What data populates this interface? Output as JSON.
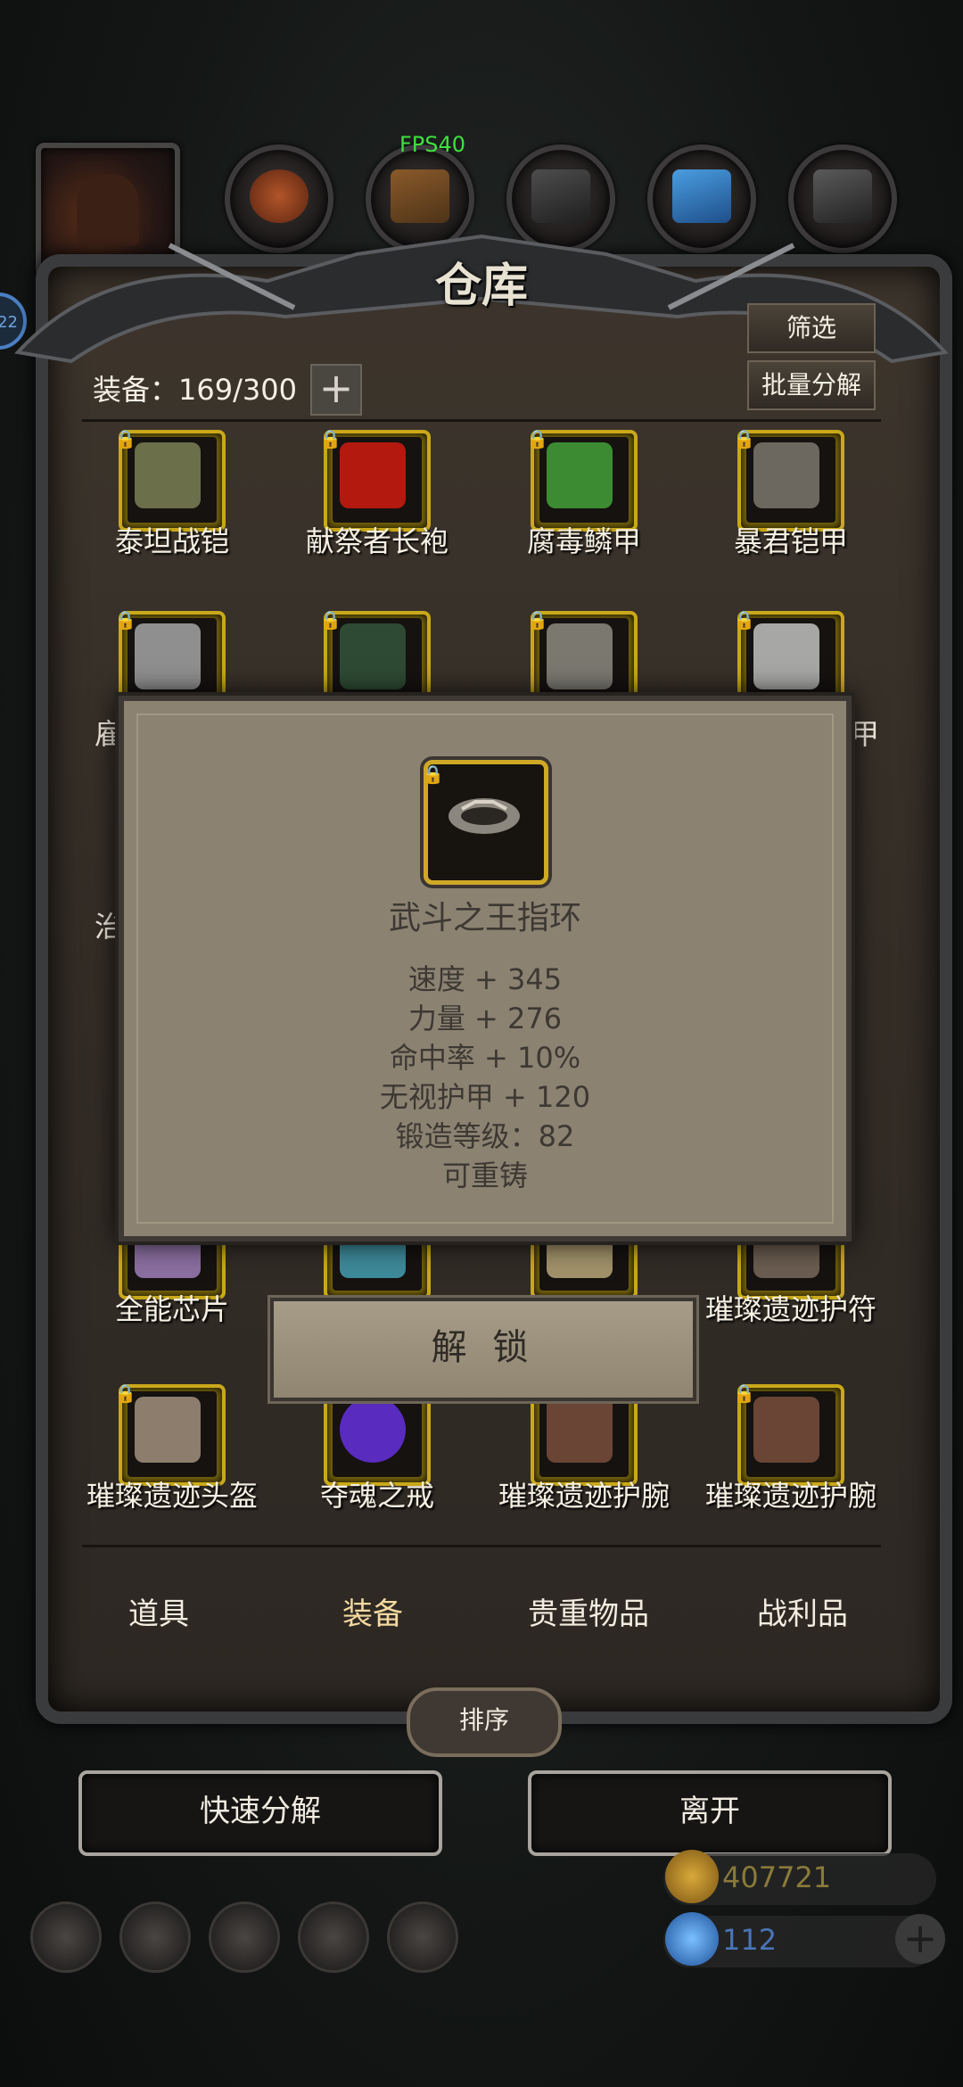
{
  "hud": {
    "fps": "FPS40"
  },
  "panel": {
    "title": "仓库",
    "filter_label": "筛选",
    "batch_label": "批量分解",
    "capacity_label": "装备：169/300",
    "plus_label": "+"
  },
  "items_row1": [
    {
      "name": "泰坦战铠",
      "color": "#6b6f4a"
    },
    {
      "name": "献祭者长袍",
      "color": "#b3190f"
    },
    {
      "name": "腐毒鳞甲",
      "color": "#3c8b32"
    },
    {
      "name": "暴君铠甲",
      "color": "#6c6860"
    }
  ],
  "items_row2_partial": [
    {
      "name": "",
      "color": "#8f8f8f"
    },
    {
      "name": "",
      "color": "#2e4a34"
    },
    {
      "name": "",
      "color": "#7b7870"
    },
    {
      "name": "",
      "color": "#a7a7a5"
    }
  ],
  "items_row4_partial": [
    {
      "name": "全能芯片",
      "color": "#8a6fa0"
    },
    {
      "name": "",
      "color": "#3d8a9a"
    },
    {
      "name": "",
      "color": "#a0916a"
    },
    {
      "name": "璀璨遗迹护符",
      "color": "#6a5c50"
    }
  ],
  "items_row5": [
    {
      "name": "璀璨遗迹头盔",
      "color": "#8d7d6c"
    },
    {
      "name": "夺魂之戒",
      "color": "#5a2bbf"
    },
    {
      "name": "璀璨遗迹护腕",
      "color": "#6a4535"
    },
    {
      "name": "璀璨遗迹护腕",
      "color": "#6a4535"
    }
  ],
  "partial_labels": {
    "left_r2": "雇",
    "right_r2": "甲",
    "left_r3": "治"
  },
  "popup": {
    "item_name": "武斗之王指环",
    "stats": [
      "速度 + 345",
      "力量 + 276",
      "命中率 + 10%",
      "无视护甲 + 120",
      "锻造等级：82",
      "可重铸"
    ]
  },
  "unlock_label": "解 锁",
  "bottom_tabs": [
    "道具",
    "装备",
    "贵重物品",
    "战利品"
  ],
  "active_tab": "装备",
  "sort_label": "排序",
  "actions": {
    "quick_decompose": "快速分解",
    "leave": "离开"
  },
  "resources": {
    "gold": "407721",
    "gems": "112"
  },
  "side_badge": "22",
  "colors": {
    "gold_border": "#c9a81a",
    "gold_text": "#8a7a3a",
    "gem_text": "#4a74b8"
  }
}
